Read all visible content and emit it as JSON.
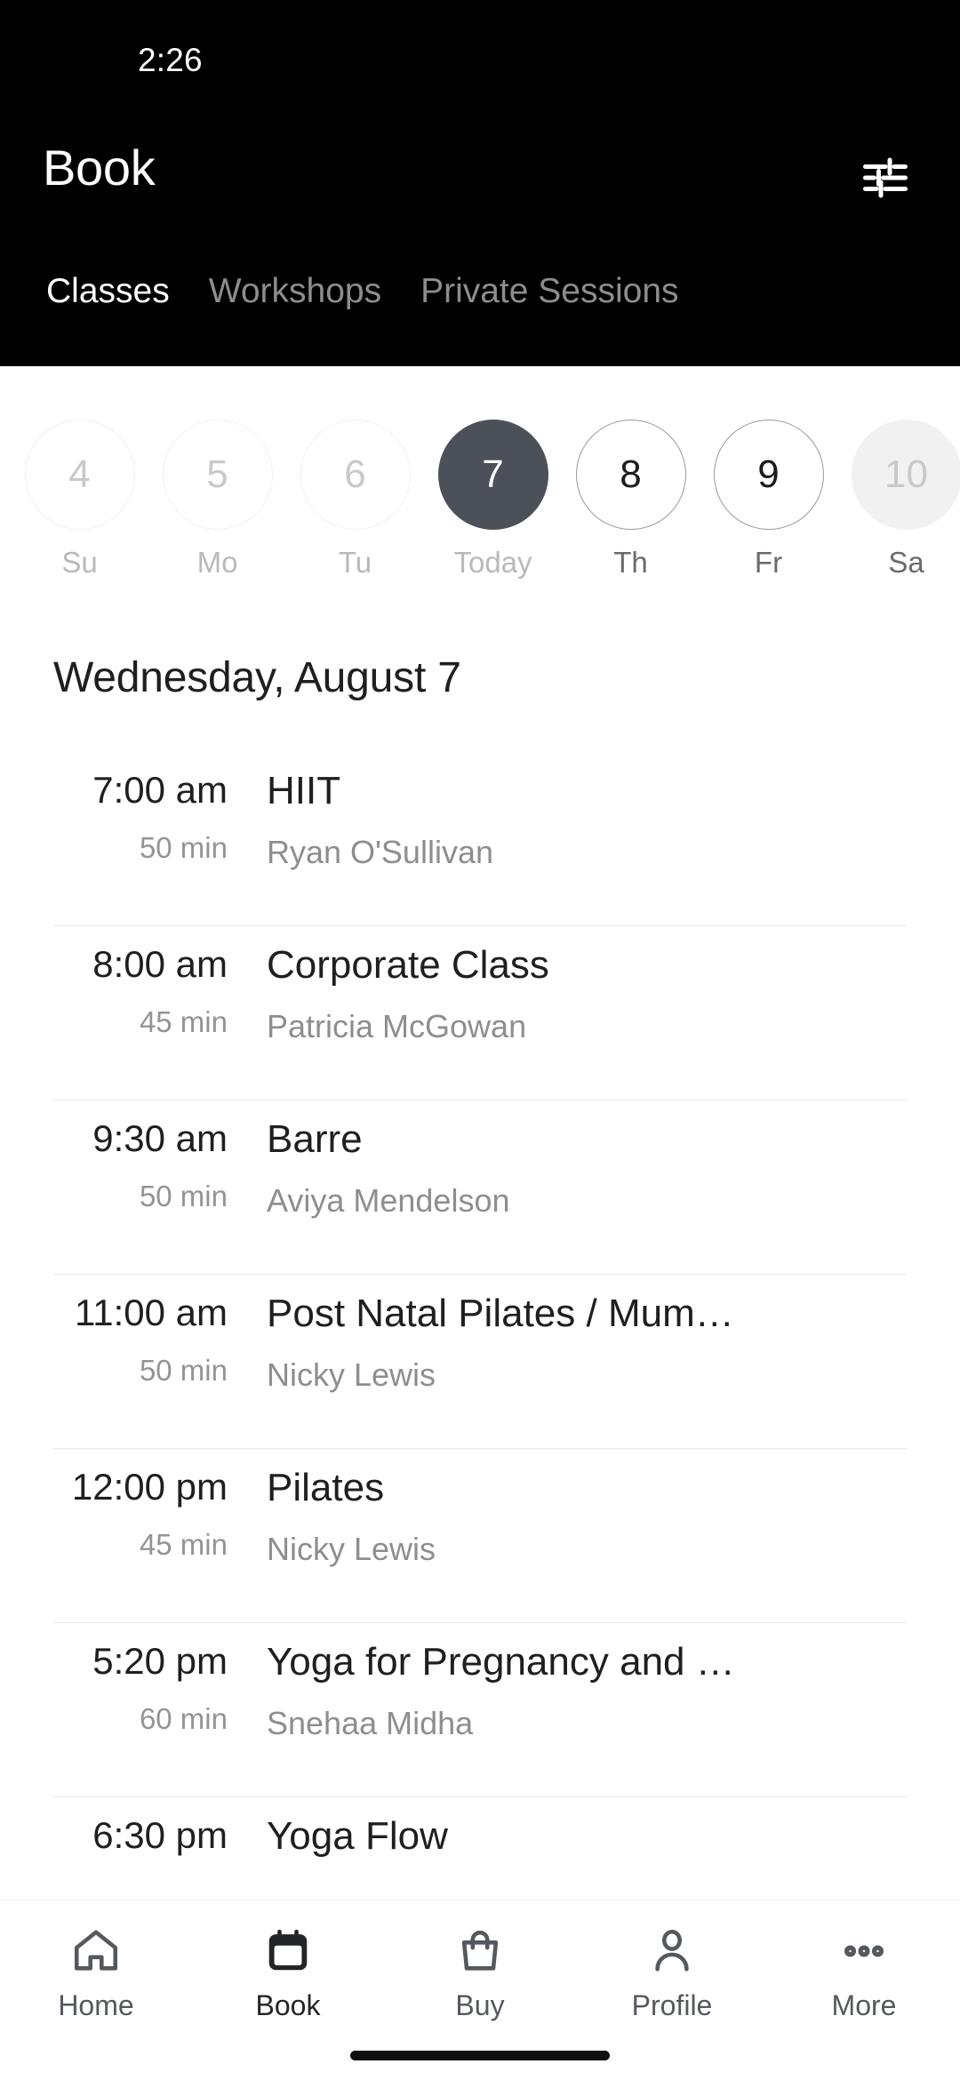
{
  "status_bar": {
    "time": "2:26"
  },
  "header": {
    "title": "Book",
    "filter_icon": "tune-filter-icon",
    "tabs": [
      {
        "label": "Classes",
        "active": true
      },
      {
        "label": "Workshops",
        "active": false
      },
      {
        "label": "Private Sessions",
        "active": false
      }
    ]
  },
  "date_strip": [
    {
      "day": "4",
      "weekday": "Su",
      "state": "disabled"
    },
    {
      "day": "5",
      "weekday": "Mo",
      "state": "disabled"
    },
    {
      "day": "6",
      "weekday": "Tu",
      "state": "disabled"
    },
    {
      "day": "7",
      "weekday": "Today",
      "state": "selected"
    },
    {
      "day": "8",
      "weekday": "Th",
      "state": "normal"
    },
    {
      "day": "9",
      "weekday": "Fr",
      "state": "normal"
    },
    {
      "day": "10",
      "weekday": "Sa",
      "state": "muted-fill"
    }
  ],
  "schedule": {
    "day_heading": "Wednesday, August 7",
    "rows": [
      {
        "time": "7:00 am",
        "duration": "50 min",
        "title": "HIIT",
        "instructor": "Ryan O'Sullivan"
      },
      {
        "time": "8:00 am",
        "duration": "45 min",
        "title": "Corporate Class",
        "instructor": "Patricia McGowan"
      },
      {
        "time": "9:30 am",
        "duration": "50 min",
        "title": "Barre",
        "instructor": "Aviya Mendelson"
      },
      {
        "time": "11:00 am",
        "duration": "50 min",
        "title": "Post Natal Pilates / Mum…",
        "instructor": "Nicky Lewis"
      },
      {
        "time": "12:00 pm",
        "duration": "45 min",
        "title": "Pilates",
        "instructor": "Nicky Lewis"
      },
      {
        "time": "5:20 pm",
        "duration": "60 min",
        "title": "Yoga for Pregnancy and …",
        "instructor": "Snehaa Midha"
      },
      {
        "time": "6:30 pm",
        "duration": "",
        "title": "Yoga Flow",
        "instructor": ""
      }
    ]
  },
  "bottom_nav": [
    {
      "label": "Home",
      "icon": "home-icon",
      "active": false
    },
    {
      "label": "Book",
      "icon": "calendar-icon",
      "active": true
    },
    {
      "label": "Buy",
      "icon": "bag-icon",
      "active": false
    },
    {
      "label": "Profile",
      "icon": "person-icon",
      "active": false
    },
    {
      "label": "More",
      "icon": "ellipsis-icon",
      "active": false
    }
  ],
  "colors": {
    "header_bg": "#000000",
    "selected_date": "#4c5058",
    "text_primary": "#1f1f21",
    "text_secondary": "#8e8e92",
    "nav_icon": "#55585e",
    "nav_active": "#242528",
    "divider": "#e8e8e8"
  }
}
